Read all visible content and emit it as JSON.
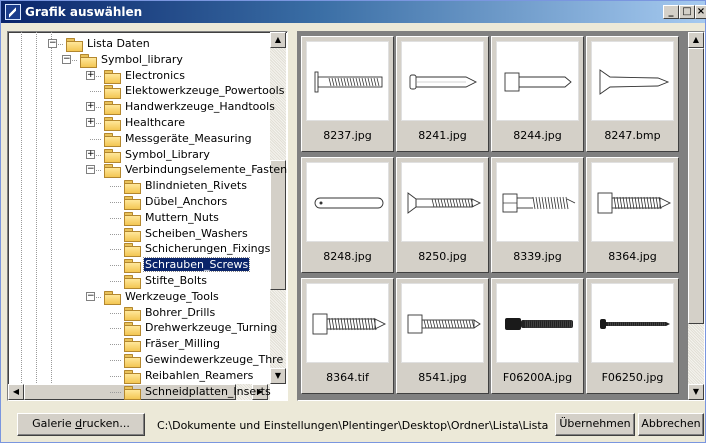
{
  "window": {
    "title": "Grafik auswählen",
    "controls": [
      "_",
      "□",
      "×"
    ]
  },
  "tree": {
    "items": [
      {
        "label": "Lista Daten",
        "level": 1,
        "expander": "−"
      },
      {
        "label": "Symbol_library",
        "level": 2,
        "expander": "−"
      },
      {
        "label": "Electronics",
        "level": 3,
        "expander": "+"
      },
      {
        "label": "Elektowerkzeuge_Powertools",
        "level": 3,
        "expander": ""
      },
      {
        "label": "Handwerkzeuge_Handtools",
        "level": 3,
        "expander": "+"
      },
      {
        "label": "Healthcare",
        "level": 3,
        "expander": "+"
      },
      {
        "label": "Messgeräte_Measuring",
        "level": 3,
        "expander": ""
      },
      {
        "label": "Symbol_Library",
        "level": 3,
        "expander": "+"
      },
      {
        "label": "Verbindungselemente_Fasten",
        "level": 3,
        "expander": "−"
      },
      {
        "label": "Blindnieten_Rivets",
        "level": 4,
        "expander": ""
      },
      {
        "label": "Dübel_Anchors",
        "level": 4,
        "expander": ""
      },
      {
        "label": "Muttern_Nuts",
        "level": 4,
        "expander": ""
      },
      {
        "label": "Scheiben_Washers",
        "level": 4,
        "expander": ""
      },
      {
        "label": "Schicherungen_Fixings",
        "level": 4,
        "expander": ""
      },
      {
        "label": "Schrauben_Screws",
        "level": 4,
        "expander": "",
        "selected": true
      },
      {
        "label": "Stifte_Bolts",
        "level": 4,
        "expander": ""
      },
      {
        "label": "Werkzeuge_Tools",
        "level": 3,
        "expander": "−"
      },
      {
        "label": "Bohrer_Drills",
        "level": 4,
        "expander": ""
      },
      {
        "label": "Drehwerkzeuge_Turning",
        "level": 4,
        "expander": ""
      },
      {
        "label": "Fräser_Milling",
        "level": 4,
        "expander": ""
      },
      {
        "label": "Gewindewerkzeuge_Thre",
        "level": 4,
        "expander": ""
      },
      {
        "label": "Reibahlen_Reamers",
        "level": 4,
        "expander": ""
      },
      {
        "label": "Schneidplatten_Inserts",
        "level": 4,
        "expander": ""
      }
    ]
  },
  "thumbnails": [
    {
      "file": "8237.jpg",
      "icon": "flat-head-screw-icon"
    },
    {
      "file": "8241.jpg",
      "icon": "pan-head-screw-icon"
    },
    {
      "file": "8244.jpg",
      "icon": "socket-head-screw-icon"
    },
    {
      "file": "8247.bmp",
      "icon": "countersunk-screw-icon"
    },
    {
      "file": "8248.jpg",
      "icon": "round-pin-icon"
    },
    {
      "file": "8250.jpg",
      "icon": "countersunk-threaded-screw-icon"
    },
    {
      "file": "8339.jpg",
      "icon": "hex-bolt-icon"
    },
    {
      "file": "8364.jpg",
      "icon": "hex-self-drilling-screw-icon"
    },
    {
      "file": "8364.tif",
      "icon": "hex-self-drilling-screw-icon"
    },
    {
      "file": "8541.jpg",
      "icon": "hex-threaded-screw-icon"
    },
    {
      "file": "F06200A.jpg",
      "icon": "black-socket-bolt-icon"
    },
    {
      "file": "F06250.jpg",
      "icon": "black-thin-screw-icon"
    }
  ],
  "footer": {
    "print_button": {
      "pre": "Galerie ",
      "accel": "d",
      "post": "rucken..."
    },
    "path": "C:\\Dokumente und Einstellungen\\Plentinger\\Desktop\\Ordner\\Lista\\Lista Daten\\Symbo",
    "accept_button": "Übernehmen",
    "cancel_button": "Abbrechen"
  }
}
